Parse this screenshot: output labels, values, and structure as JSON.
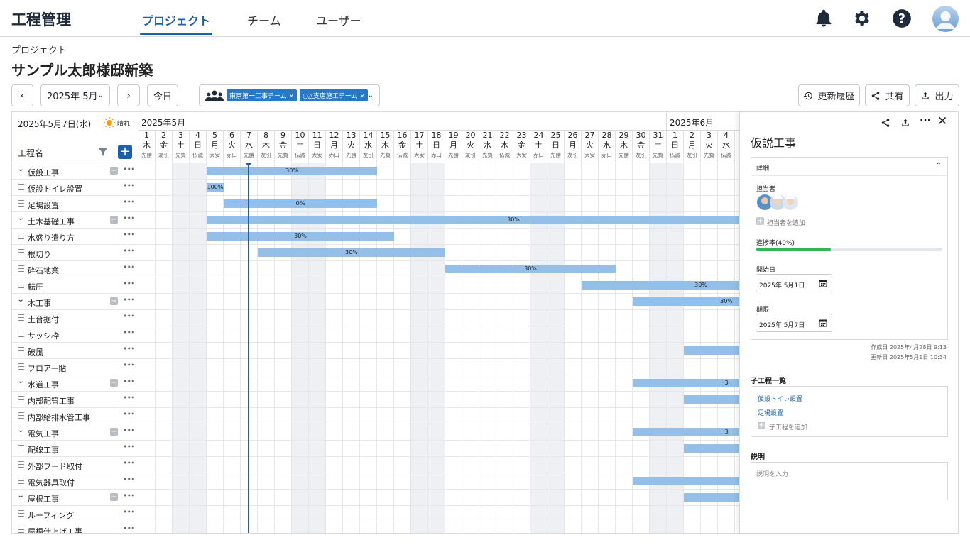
{
  "app": {
    "title": "工程管理"
  },
  "nav": {
    "tabs": [
      "プロジェクト",
      "チーム",
      "ユーザー"
    ],
    "active": 0
  },
  "header_icons": [
    "bell-icon",
    "gear-icon",
    "help-icon",
    "user-avatar"
  ],
  "breadcrumb": "プロジェクト",
  "project_title": "サンプル太郎様邸新築",
  "toolbar": {
    "month_select": "2025年 5月",
    "today_label": "今日",
    "teams": [
      "東京第一工事チーム ×",
      "○△支店施工チーム ×"
    ],
    "history_label": "更新履歴",
    "share_label": "共有",
    "export_label": "出力"
  },
  "gantt": {
    "date_label": "2025年5月7日(水)",
    "weather": "晴れ",
    "column_header": "工程名",
    "months": [
      "2025年5月",
      "2025年6月"
    ],
    "days": [
      {
        "d": "1",
        "w": "木",
        "r": "先勝"
      },
      {
        "d": "2",
        "w": "金",
        "r": "友引"
      },
      {
        "d": "3",
        "w": "土",
        "r": "先負"
      },
      {
        "d": "4",
        "w": "日",
        "r": "仏滅"
      },
      {
        "d": "5",
        "w": "月",
        "r": "大安"
      },
      {
        "d": "6",
        "w": "火",
        "r": "赤口"
      },
      {
        "d": "7",
        "w": "水",
        "r": "先勝"
      },
      {
        "d": "8",
        "w": "木",
        "r": "友引"
      },
      {
        "d": "9",
        "w": "金",
        "r": "先負"
      },
      {
        "d": "10",
        "w": "土",
        "r": "仏滅"
      },
      {
        "d": "11",
        "w": "日",
        "r": "大安"
      },
      {
        "d": "12",
        "w": "月",
        "r": "赤口"
      },
      {
        "d": "13",
        "w": "火",
        "r": "先勝"
      },
      {
        "d": "14",
        "w": "水",
        "r": "友引"
      },
      {
        "d": "15",
        "w": "木",
        "r": "先負"
      },
      {
        "d": "16",
        "w": "金",
        "r": "仏滅"
      },
      {
        "d": "17",
        "w": "土",
        "r": "大安"
      },
      {
        "d": "18",
        "w": "日",
        "r": "赤口"
      },
      {
        "d": "19",
        "w": "月",
        "r": "先勝"
      },
      {
        "d": "20",
        "w": "火",
        "r": "友引"
      },
      {
        "d": "21",
        "w": "水",
        "r": "先負"
      },
      {
        "d": "22",
        "w": "木",
        "r": "仏滅"
      },
      {
        "d": "23",
        "w": "金",
        "r": "大安"
      },
      {
        "d": "24",
        "w": "土",
        "r": "赤口"
      },
      {
        "d": "25",
        "w": "日",
        "r": "先勝"
      },
      {
        "d": "26",
        "w": "月",
        "r": "友引"
      },
      {
        "d": "27",
        "w": "火",
        "r": "大安"
      },
      {
        "d": "28",
        "w": "水",
        "r": "赤口"
      },
      {
        "d": "29",
        "w": "木",
        "r": "先勝"
      },
      {
        "d": "30",
        "w": "金",
        "r": "友引"
      },
      {
        "d": "31",
        "w": "土",
        "r": "先負"
      },
      {
        "d": "1",
        "w": "日",
        "r": "仏滅"
      },
      {
        "d": "2",
        "w": "月",
        "r": "友引"
      },
      {
        "d": "3",
        "w": "火",
        "r": "先負"
      },
      {
        "d": "4",
        "w": "水",
        "r": "仏滅"
      }
    ],
    "rows": [
      {
        "name": "仮設工事",
        "group": true,
        "bar": [
          5,
          14
        ],
        "label": "30%"
      },
      {
        "name": "仮設トイレ設置",
        "group": false,
        "bar": [
          5,
          5
        ],
        "label": "100%"
      },
      {
        "name": "足場設置",
        "group": false,
        "bar": [
          6,
          14
        ],
        "label": "0%"
      },
      {
        "name": "土木基礎工事",
        "group": true,
        "bar": [
          5,
          40
        ],
        "label": "30%"
      },
      {
        "name": "水盛り遣り方",
        "group": false,
        "bar": [
          5,
          15
        ],
        "label": "30%"
      },
      {
        "name": "根切り",
        "group": false,
        "bar": [
          8,
          18
        ],
        "label": "30%"
      },
      {
        "name": "砕石地業",
        "group": false,
        "bar": [
          19,
          28
        ],
        "label": "30%"
      },
      {
        "name": "転圧",
        "group": false,
        "bar": [
          27,
          40
        ],
        "label": "30%"
      },
      {
        "name": "木工事",
        "group": true,
        "bar": [
          30,
          40
        ],
        "label": "30%"
      },
      {
        "name": "土台据付",
        "group": false,
        "bar": null,
        "label": ""
      },
      {
        "name": "サッシ枠",
        "group": false,
        "bar": null,
        "label": ""
      },
      {
        "name": "破風",
        "group": false,
        "bar": [
          33,
          40
        ],
        "label": ""
      },
      {
        "name": "フロアー貼",
        "group": false,
        "bar": null,
        "label": ""
      },
      {
        "name": "水道工事",
        "group": true,
        "bar": [
          30,
          40
        ],
        "label": "3"
      },
      {
        "name": "内部配管工事",
        "group": false,
        "bar": [
          33,
          40
        ],
        "label": ""
      },
      {
        "name": "内部給排水管工事",
        "group": false,
        "bar": null,
        "label": ""
      },
      {
        "name": "電気工事",
        "group": true,
        "bar": [
          30,
          40
        ],
        "label": "3"
      },
      {
        "name": "配線工事",
        "group": false,
        "bar": [
          33,
          40
        ],
        "label": ""
      },
      {
        "name": "外部フード取付",
        "group": false,
        "bar": null,
        "label": ""
      },
      {
        "name": "電気器具取付",
        "group": false,
        "bar": [
          30,
          40
        ],
        "label": ""
      },
      {
        "name": "屋根工事",
        "group": true,
        "bar": [
          33,
          40
        ],
        "label": ""
      },
      {
        "name": "ルーフィング",
        "group": false,
        "bar": null,
        "label": ""
      },
      {
        "name": "屋根仕上げ工事",
        "group": false,
        "bar": null,
        "label": ""
      }
    ]
  },
  "panel": {
    "title": "仮説工事",
    "section_details": "詳細",
    "assignee_label": "担当者",
    "add_assignee": "担当者を追加",
    "progress_label": "進捗率(40%)",
    "progress": 0.4,
    "start_label": "開始日",
    "start_value": "2025年 5月1日",
    "due_label": "期限",
    "due_value": "2025年 5月7日",
    "created": "作成日 2025年4月28日 9:13",
    "updated": "更新日 2025年5月1日 10:34",
    "children_label": "子工程一覧",
    "children": [
      "仮設トイレ設置",
      "足場設置"
    ],
    "add_child": "子工程を追加",
    "desc_label": "説明",
    "desc_placeholder": "説明を入力"
  },
  "colors": {
    "accent": "#1d5fa8",
    "bar": "#93bfe9",
    "progress": "#2eb85c",
    "chip": "#2878c8"
  }
}
